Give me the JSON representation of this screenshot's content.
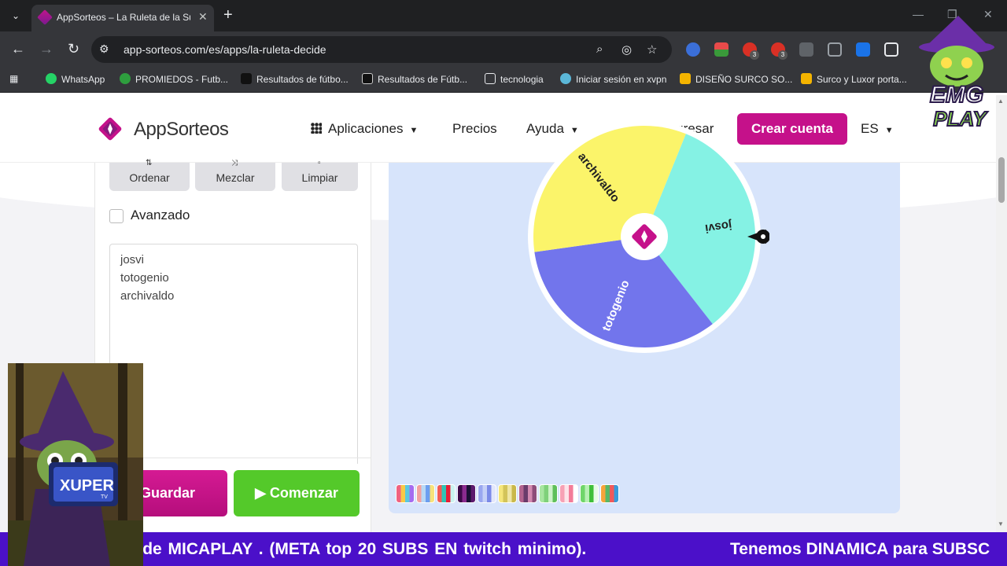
{
  "browser": {
    "tab_title": "AppSorteos – La Ruleta de la Su",
    "url": "app-sorteos.com/es/apps/la-ruleta-decide",
    "bookmarks": [
      {
        "label": "WhatsApp",
        "color": "#25d366"
      },
      {
        "label": "PROMIEDOS - Futb...",
        "color": "#2e9e3e"
      },
      {
        "label": "Resultados de fútbo...",
        "color": "#1a1a1a"
      },
      {
        "label": "Resultados de Fútb...",
        "color": "#111111"
      },
      {
        "label": "tecnologia",
        "color": "folder"
      },
      {
        "label": "Iniciar sesión en xvpn",
        "color": "#5bb7d8"
      },
      {
        "label": "DISEÑO SURCO SO...",
        "color": "#f4b400"
      },
      {
        "label": "Surco y Luxor porta...",
        "color": "#f4b400"
      }
    ],
    "badges": [
      "3",
      "3"
    ]
  },
  "navbar": {
    "logo_text": "AppSorteos",
    "apps": "Aplicaciones",
    "pricing": "Precios",
    "help": "Ayuda",
    "login": "Ingresar",
    "signup": "Crear cuenta",
    "lang": "ES"
  },
  "left_panel": {
    "sort": "Ordenar",
    "shuffle": "Mezclar",
    "clear": "Limpiar",
    "advanced": "Avanzado",
    "names": [
      "josvi",
      "totogenio",
      "archivaldo"
    ],
    "save": "Guardar",
    "start": "Comenzar"
  },
  "wheel": {
    "segments": [
      {
        "label": "josvi",
        "color": "#85f2e4"
      },
      {
        "label": "totogenio",
        "color": "#7275ec"
      },
      {
        "label": "archivaldo",
        "color": "#fbf46a"
      }
    ]
  },
  "palettes": [
    [
      "#f0627f",
      "#f7c948",
      "#5ac8e0",
      "#a56cf0"
    ],
    [
      "#f3a0a0",
      "#b8d8f5",
      "#6c9ef0",
      "#f7e27a"
    ],
    [
      "#f25c54",
      "#2ec4b6",
      "#e71d36",
      "#cbf3f0"
    ],
    [
      "#3d0a49",
      "#8a2b8f",
      "#1b1035",
      "#5c1a6e"
    ],
    [
      "#9aa7f0",
      "#c6d0f7",
      "#7b8ae8",
      "#e3e7fb"
    ],
    [
      "#f5e67b",
      "#d3c45a",
      "#efe6a6",
      "#c9b84b"
    ],
    [
      "#b3638f",
      "#6a3b6b",
      "#d38ab1",
      "#8d4d7a"
    ],
    [
      "#a8e6a1",
      "#7fd17a",
      "#cdf2c8",
      "#5fbf5a"
    ],
    [
      "#f7a1b5",
      "#fde2e8",
      "#f37c99",
      "#ffffff"
    ],
    [
      "#6fd66a",
      "#b8f0b4",
      "#3fbf3a",
      "#e6fbe4"
    ],
    [
      "#f7a43b",
      "#58b868",
      "#f15a5a",
      "#3a9ad9"
    ]
  ],
  "ticker": {
    "text1": "es de MICAPLAY .  (META  top 20 SUBS  EN  twitch minimo).",
    "text2": "Tenemos DINAMICA para SUBSC"
  },
  "overlay": {
    "emg_line1": "EMG",
    "emg_line2": "PLAY",
    "tv_brand": "XUPER",
    "tv_sub": "TV"
  }
}
